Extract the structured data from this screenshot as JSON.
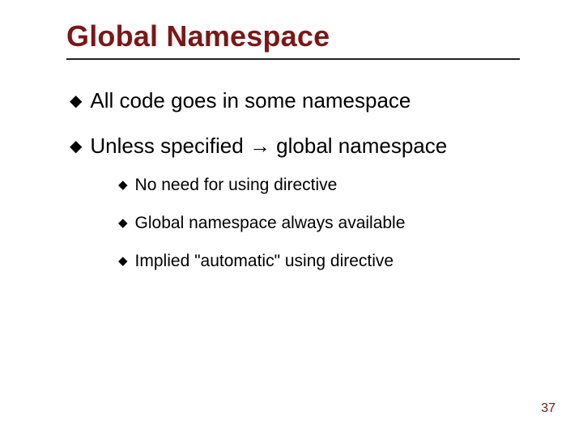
{
  "title": "Global Namespace",
  "bullets": {
    "b1": "All code goes in some namespace",
    "b2_pre": "Unless specified ",
    "b2_arrow": "→",
    "b2_post": " global namespace",
    "s1": "No need for using directive",
    "s2": "Global namespace always available",
    "s3": "Implied \"automatic\" using directive"
  },
  "page_number": "37"
}
